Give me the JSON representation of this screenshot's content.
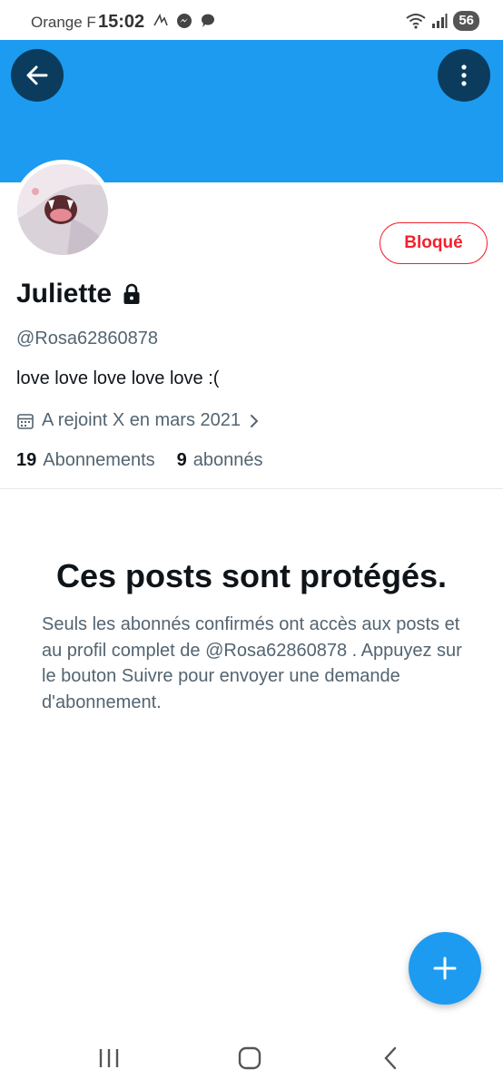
{
  "status_bar": {
    "carrier": "Orange F",
    "time": "15:02",
    "battery": "56"
  },
  "profile": {
    "display_name": "Juliette",
    "handle": "@Rosa62860878",
    "bio": "love love love love love :(",
    "joined": "A rejoint X en mars 2021",
    "following_count": "19",
    "following_label": "Abonnements",
    "followers_count": "9",
    "followers_label": "abonnés",
    "blocked_label": "Bloqué"
  },
  "protected": {
    "title": "Ces posts sont protégés.",
    "message": "Seuls les abonnés confirmés ont accès aux posts et au profil complet de @Rosa62860878 . Appuyez sur le bouton Suivre pour envoyer une demande d'abonnement."
  },
  "colors": {
    "accent": "#1d9bf0",
    "blocked": "#f4212e",
    "header_button": "#0b3c5d",
    "secondary_text": "#536471"
  },
  "icons": {
    "back": "arrow-left-icon",
    "more": "more-vertical-icon",
    "lock": "lock-icon",
    "calendar": "calendar-icon",
    "chevron": "chevron-right-icon",
    "fab": "plus-icon"
  }
}
